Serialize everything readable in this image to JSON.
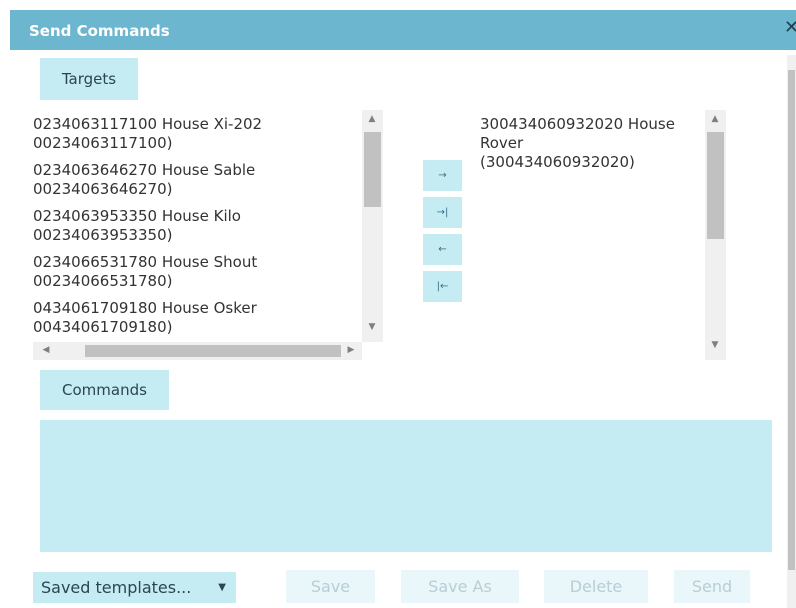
{
  "dialog": {
    "title": "Send Commands",
    "close_icon": "close-icon"
  },
  "targets": {
    "button_label": "Targets",
    "available": [
      {
        "line1": "0234063117100 House Xi-202",
        "line2": "00234063117100)"
      },
      {
        "line1": "0234063646270 House Sable",
        "line2": "00234063646270)"
      },
      {
        "line1": "0234063953350 House Kilo",
        "line2": "00234063953350)"
      },
      {
        "line1": "0234066531780 House Shout",
        "line2": "00234066531780)"
      },
      {
        "line1": "0434061709180 House Osker",
        "line2": "00434061709180)"
      }
    ],
    "selected": [
      {
        "line1": "300434060932020 House",
        "line2": "Rover",
        "line3": "(300434060932020)"
      }
    ],
    "move_buttons": {
      "add": "→",
      "add_all": "→|",
      "remove": "←",
      "remove_all": "|←"
    }
  },
  "commands": {
    "button_label": "Commands",
    "text": ""
  },
  "footer": {
    "templates_label": "Saved templates...",
    "save": "Save",
    "save_as": "Save As",
    "delete": "Delete",
    "send": "Send"
  },
  "colors": {
    "titlebar": "#6db6cf",
    "button_bg": "#c5ebf3",
    "disabled_bg": "#e9f7fa"
  }
}
